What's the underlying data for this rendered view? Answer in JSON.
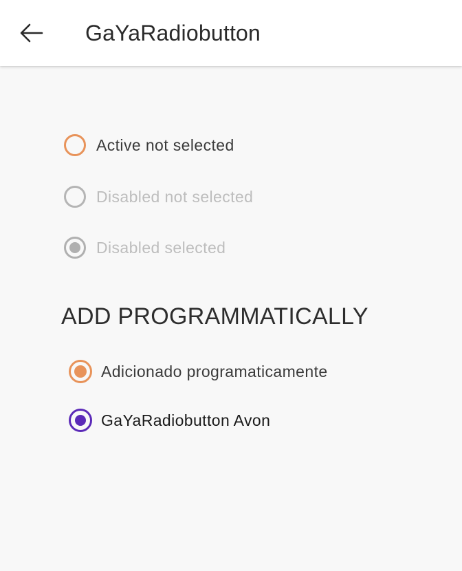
{
  "app_bar": {
    "title": "GaYaRadiobutton",
    "back_icon": "arrow-left-icon"
  },
  "radios": [
    {
      "label": "Active not selected",
      "state": "active",
      "selected": false,
      "color": "#e8935a"
    },
    {
      "label": "Disabled not selected",
      "state": "disabled",
      "selected": false,
      "color": "#b5b5b5"
    },
    {
      "label": "Disabled selected",
      "state": "disabled",
      "selected": true,
      "color": "#b0b0b0"
    }
  ],
  "section": {
    "heading": "ADD PROGRAMMATICALLY"
  },
  "programmatic_radios": [
    {
      "label": "Adicionado programaticamente",
      "state": "active",
      "selected": true,
      "color": "#e8935a"
    },
    {
      "label": "GaYaRadiobutton Avon",
      "state": "active",
      "selected": true,
      "color": "#5b2ab8"
    }
  ],
  "colors": {
    "background": "#f8f8f8",
    "app_bar": "#ffffff",
    "accent_orange": "#e8935a",
    "accent_purple": "#5b2ab8"
  }
}
